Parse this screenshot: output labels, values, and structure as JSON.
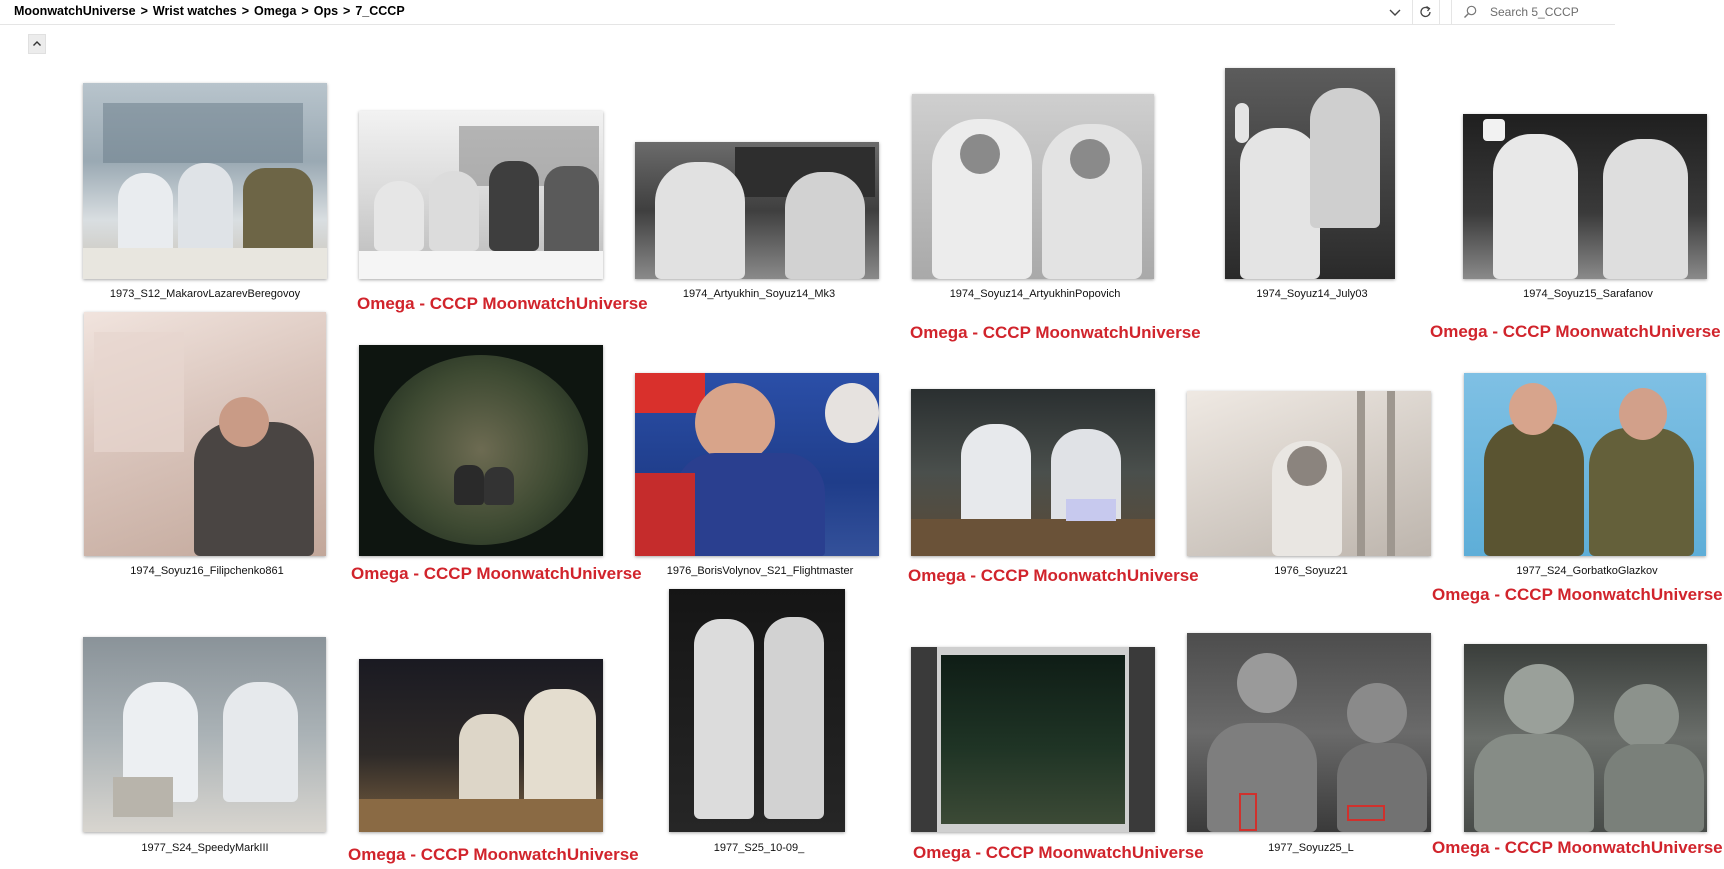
{
  "address_bar": {
    "breadcrumb": [
      "MoonwatchUniverse",
      "Wrist watches",
      "Omega",
      "Ops",
      "7_CCCP"
    ],
    "separator": ">",
    "search_placeholder": "Search 5_CCCP"
  },
  "watermark_text": "Omega - CCCP  MoonwatchUniverse",
  "files": [
    {
      "name": "1973_S12_MakarovLazarevBeregovoy"
    },
    {
      "name": ""
    },
    {
      "name": "1974_Artyukhin_Soyuz14_Mk3"
    },
    {
      "name": "1974_Soyuz14_ArtyukhinPopovich"
    },
    {
      "name": "1974_Soyuz14_July03"
    },
    {
      "name": "1974_Soyuz15_Sarafanov"
    },
    {
      "name": "1974_Soyuz16_Filipchenko861"
    },
    {
      "name": ""
    },
    {
      "name": "1976_BorisVolynov_S21_Flightmaster"
    },
    {
      "name": ""
    },
    {
      "name": "1976_Soyuz21"
    },
    {
      "name": "1977_S24_GorbatkoGlazkov"
    },
    {
      "name": "1977_S24_SpeedyMarkIII"
    },
    {
      "name": ""
    },
    {
      "name": "1977_S25_10-09_"
    },
    {
      "name": ""
    },
    {
      "name": "1977_Soyuz25_L"
    },
    {
      "name": ""
    }
  ],
  "icons": {
    "dropdown": "chevron-down-icon",
    "refresh": "refresh-icon",
    "search": "search-icon",
    "collapse": "chevron-up-icon"
  }
}
